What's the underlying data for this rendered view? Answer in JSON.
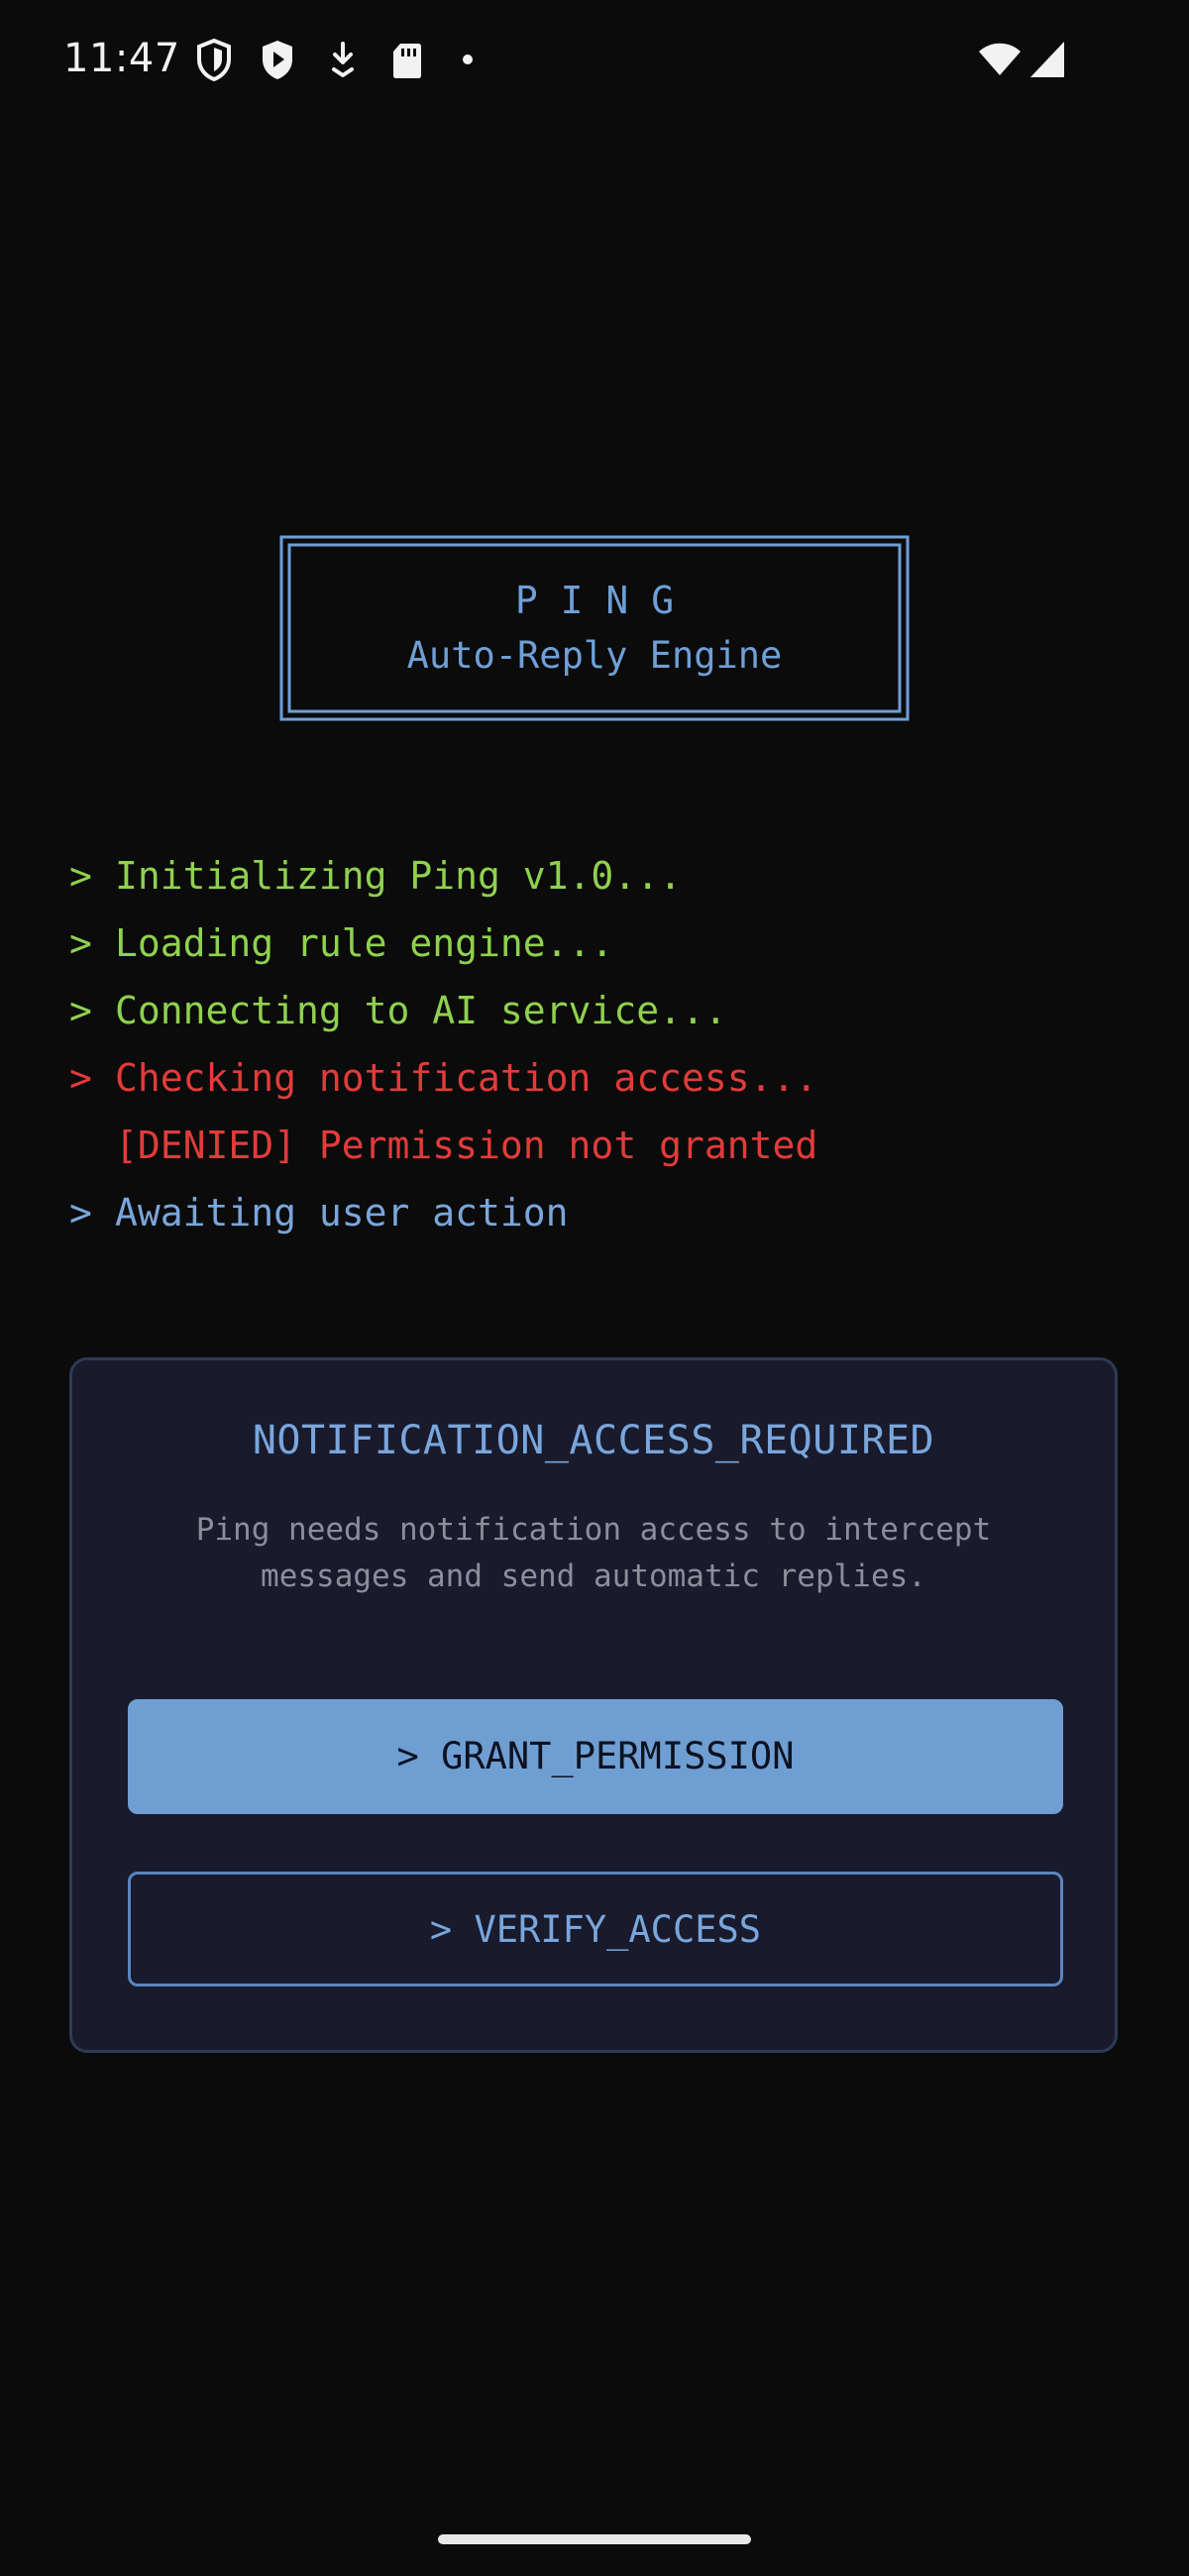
{
  "status_bar": {
    "time": "11:47",
    "icons": [
      "shield-icon",
      "play-protect-icon",
      "download-icon",
      "sd-card-icon",
      "dot-icon",
      "wifi-icon",
      "signal-icon"
    ]
  },
  "title": {
    "letters": "P  I  N  G",
    "subtitle": "Auto-Reply Engine"
  },
  "log": [
    {
      "prompt": ">",
      "text": "Initializing Ping v1.0...",
      "color": "#8fd14f"
    },
    {
      "prompt": ">",
      "text": "Loading rule engine...",
      "color": "#8fd14f"
    },
    {
      "prompt": ">",
      "text": "Connecting to AI service...",
      "color": "#8fd14f"
    },
    {
      "prompt": ">",
      "text": "Checking notification access...",
      "color": "#e23b3b"
    },
    {
      "prompt": "",
      "text": "[DENIED] Permission not granted",
      "color": "#e23b3b"
    },
    {
      "prompt": ">",
      "text": "Awaiting user action",
      "color": "#79a6dc"
    }
  ],
  "card": {
    "title": "NOTIFICATION_ACCESS_REQUIRED",
    "description": "Ping needs notification access to intercept messages and send automatic replies.",
    "grant_button": "> GRANT_PERMISSION",
    "verify_button": "> VERIFY_ACCESS"
  },
  "colors": {
    "background": "#0b0b0b",
    "accent_blue": "#6f9ed2",
    "log_green": "#8fd14f",
    "log_red": "#e23b3b",
    "card_bg": "#191a2c"
  }
}
